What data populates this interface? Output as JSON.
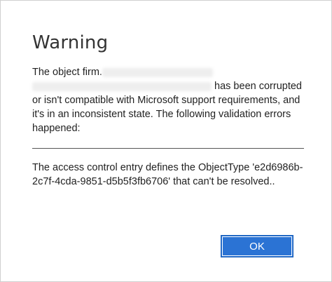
{
  "dialog": {
    "title": "Warning",
    "message": {
      "prefix": "The object firm.",
      "suffix_first_line": " has been corrupted",
      "rest": "or isn't compatible with Microsoft support requirements, and it's in an inconsistent state. The following validation errors happened:"
    },
    "detail": "The access control entry defines the ObjectType 'e2d6986b-2c7f-4cda-9851-d5b5f3fb6706' that can't be resolved..",
    "ok_label": "OK"
  }
}
